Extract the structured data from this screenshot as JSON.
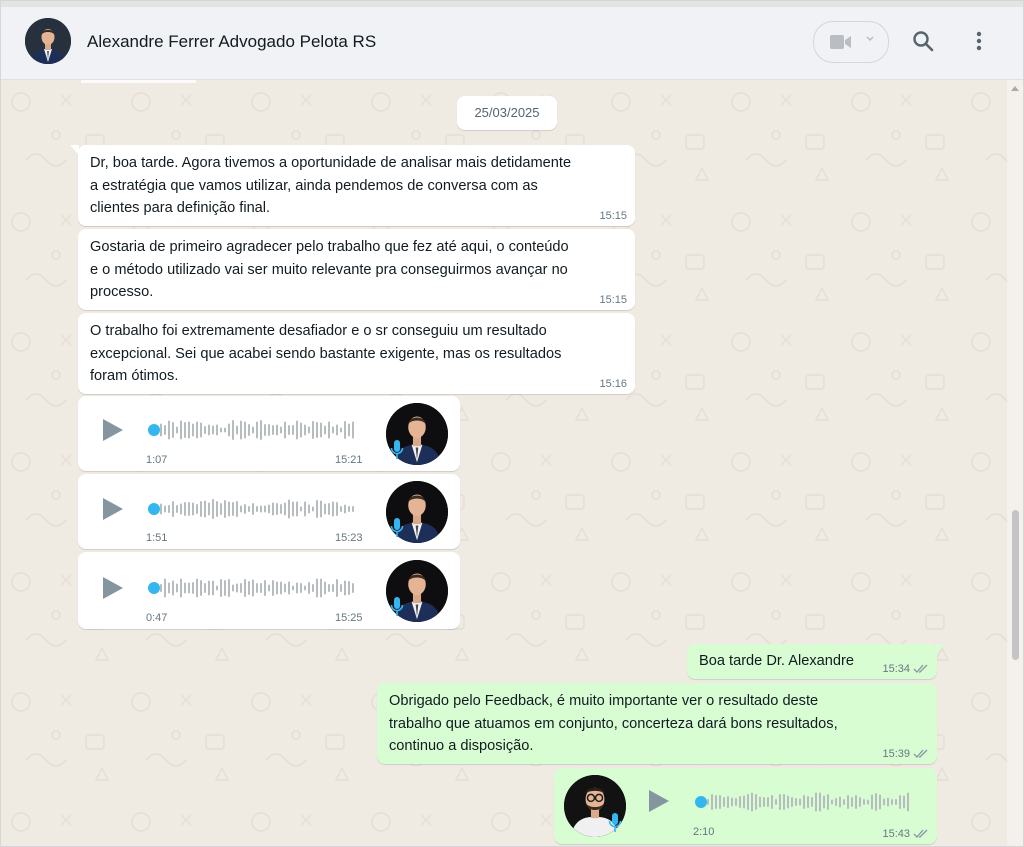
{
  "header": {
    "contact_name": "Alexandre Ferrer Advogado Pelota RS",
    "icons": [
      "avatar",
      "video-camera-icon",
      "chevron-down-icon",
      "search-icon",
      "kebab-menu-icon"
    ]
  },
  "date_separator": "25/03/2025",
  "messages": [
    {
      "direction": "in",
      "type": "text",
      "text": "Dr, boa tarde. Agora tivemos a oportunidade de analisar mais detidamente\na estratégia que vamos utilizar, ainda pendemos de conversa com as\nclientes para definição final.",
      "time": "15:15"
    },
    {
      "direction": "in",
      "type": "text",
      "text": "Gostaria de primeiro agradecer pelo trabalho que fez até aqui, o conteúdo\ne o método utilizado vai ser muito relevante pra conseguirmos avançar no\nprocesso.",
      "time": "15:15"
    },
    {
      "direction": "in",
      "type": "text",
      "text": "O trabalho foi extremamente desafiador e o sr conseguiu um resultado\nexcepcional. Sei que acabei sendo bastante exigente, mas os resultados\nforam ótimos.",
      "time": "15:16"
    },
    {
      "direction": "in",
      "type": "voice",
      "duration": "1:07",
      "time": "15:21",
      "progress": 0
    },
    {
      "direction": "in",
      "type": "voice",
      "duration": "1:51",
      "time": "15:23",
      "progress": 0
    },
    {
      "direction": "in",
      "type": "voice",
      "duration": "0:47",
      "time": "15:25",
      "progress": 0
    },
    {
      "direction": "out",
      "type": "text",
      "text": "Boa tarde Dr. Alexandre",
      "time": "15:34",
      "status": "read"
    },
    {
      "direction": "out",
      "type": "text",
      "text": "Obrigado pelo Feedback, é muito importante ver o resultado deste\ntrabalho que atuamos em conjunto, concerteza dará bons resultados,\ncontinuo a disposição.",
      "time": "15:39",
      "status": "read"
    },
    {
      "direction": "out",
      "type": "voice",
      "duration": "2:10",
      "time": "15:43",
      "status": "read",
      "progress": 0
    }
  ],
  "colors": {
    "wallpaper": "#efeae2",
    "incoming_bubble": "#ffffff",
    "outgoing_bubble": "#d9fdd3",
    "voice_dot": "#34b7f1",
    "tick_read": "#8696a0"
  }
}
